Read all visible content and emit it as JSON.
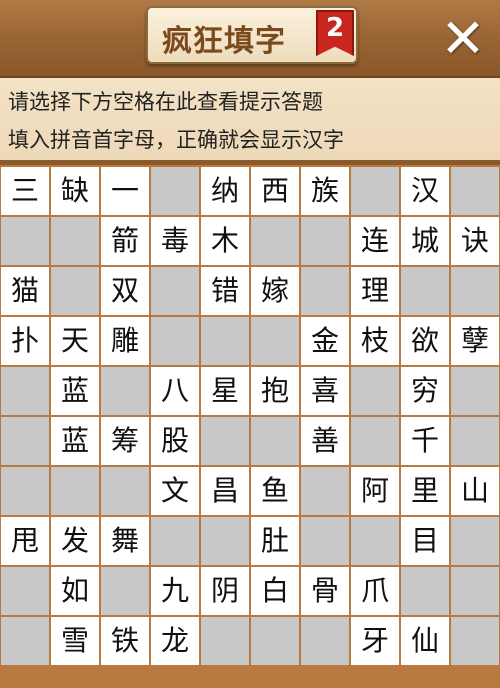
{
  "header": {
    "title": "疯狂填字",
    "badge": "2",
    "close_icon": "close-icon"
  },
  "hints": {
    "line1": "请选择下方空格在此查看提示答题",
    "line2": "填入拼音首字母，正确就会显示汉字"
  },
  "grid": [
    [
      "三",
      "缺",
      "一",
      "",
      "纳",
      "西",
      "族",
      "",
      "汉",
      ""
    ],
    [
      "",
      "",
      "箭",
      "毒",
      "木",
      "",
      "",
      "连",
      "城",
      "诀"
    ],
    [
      "猫",
      "",
      "双",
      "",
      "错",
      "嫁",
      "",
      "理",
      "",
      ""
    ],
    [
      "扑",
      "天",
      "雕",
      "",
      "",
      "",
      "金",
      "枝",
      "欲",
      "孽"
    ],
    [
      "",
      "蓝",
      "",
      "八",
      "星",
      "抱",
      "喜",
      "",
      "穷",
      ""
    ],
    [
      "",
      "蓝",
      "筹",
      "股",
      "",
      "",
      "善",
      "",
      "千",
      ""
    ],
    [
      "",
      "",
      "",
      "文",
      "昌",
      "鱼",
      "",
      "阿",
      "里",
      "山"
    ],
    [
      "甩",
      "发",
      "舞",
      "",
      "",
      "肚",
      "",
      "",
      "目",
      ""
    ],
    [
      "",
      "如",
      "",
      "九",
      "阴",
      "白",
      "骨",
      "爪",
      "",
      ""
    ],
    [
      "",
      "雪",
      "铁",
      "龙",
      "",
      "",
      "",
      "牙",
      "仙",
      ""
    ]
  ]
}
